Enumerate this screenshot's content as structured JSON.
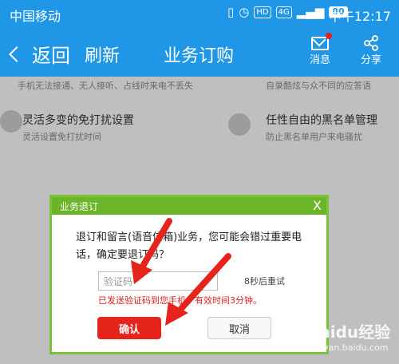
{
  "status_bar": {
    "carrier": "中国移动",
    "badges": [
      "HD",
      "4G"
    ],
    "battery": "80",
    "time": "中午12:17"
  },
  "nav": {
    "back": "返回",
    "refresh": "刷新",
    "title": "业务订购",
    "message": "消息",
    "share": "分享"
  },
  "features": [
    {
      "title": "",
      "subtitle": "手机无法接通、无人接听、占线时来电不丢失"
    },
    {
      "title": "",
      "subtitle": "自录酷炫与众不同的应答语"
    },
    {
      "title": "灵活多变的免打扰设置",
      "subtitle": "灵活设置免打扰时间"
    },
    {
      "title": "任性自由的黑名单管理",
      "subtitle": "防止黑名单用户来电骚扰"
    }
  ],
  "dialog": {
    "title": "业务退订",
    "close": "X",
    "message": "退订和留言(语音信箱)业务，您可能会错过重要电话，确定要退订吗？",
    "code_placeholder": "验证码",
    "retry": "8秒后重试",
    "sent_notice": "已发送验证码到您手机，有效时间3分钟。",
    "confirm": "确认",
    "cancel": "取消"
  },
  "watermark": {
    "brand": "Baidu经验",
    "sub": "jingyan.baidu.com"
  },
  "colors": {
    "header": "#1f97e6",
    "dialog_border": "#7cc13a",
    "confirm": "#e5241b",
    "arrow": "#e5241b"
  }
}
